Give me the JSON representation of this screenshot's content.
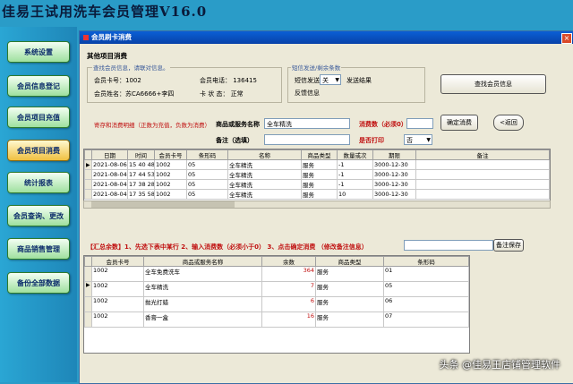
{
  "app": {
    "title": "佳易王试用洗车会员管理V16.0",
    "watermark": "头条 @佳易王店铺管理软件"
  },
  "nav": [
    {
      "label": "系统设置"
    },
    {
      "label": "会员信息登记"
    },
    {
      "label": "会员项目充值"
    },
    {
      "label": "会员项目消费"
    },
    {
      "label": "统计报表"
    },
    {
      "label": "会员查询、更改"
    },
    {
      "label": "商品销售管理"
    },
    {
      "label": "备份全部数据"
    }
  ],
  "window": {
    "title": "会员刷卡消费",
    "close": "×"
  },
  "section": {
    "title": "其他项目消费"
  },
  "member": {
    "group_label": "查找会员信息，请联对信息。",
    "card_no": "会员卡号：1002",
    "phone": "会员电话： 136415",
    "name": "会员姓名：苏CA6666+李四",
    "status": "卡 状 态： 正常"
  },
  "sms": {
    "group_label": "短信发送/剩余条数",
    "send_label": "短信发送",
    "send_value": "关",
    "result_label": "发送结果",
    "feedback_label": "反馈信息"
  },
  "buttons": {
    "find_member": "查找会员信息",
    "confirm": "确定消费",
    "back": "<返回",
    "save_note": "备注保存"
  },
  "form": {
    "hint": "寄存和消费明细（正数为充值，负数为消费）",
    "item_label": "商品或服务名称",
    "item_value": "全车精洗",
    "qty_label": "消费数（必须0）",
    "qty_value": "",
    "note_label": "备注（选填）",
    "note_value": "",
    "print_label": "是否打印",
    "print_value": "否"
  },
  "history": {
    "columns": [
      "日期",
      "时间",
      "会员卡号",
      "条形码",
      "名称",
      "商品类型",
      "数量或次",
      "期限",
      "备注"
    ],
    "rows": [
      [
        "2021-08-06",
        "15 40 48",
        "1002",
        "05",
        "全车精洗",
        "服务",
        "-1",
        "3000-12-30",
        ""
      ],
      [
        "2021-08-04",
        "17 44 53",
        "1002",
        "05",
        "全车精洗",
        "服务",
        "-1",
        "3000-12-30",
        ""
      ],
      [
        "2021-08-04",
        "17 38 28",
        "1002",
        "05",
        "全车精洗",
        "服务",
        "-1",
        "3000-12-30",
        ""
      ],
      [
        "2021-08-04",
        "17 35 58",
        "1002",
        "05",
        "全车精洗",
        "服务",
        "10",
        "3000-12-30",
        ""
      ]
    ]
  },
  "summary": {
    "text": "【汇总余数】1、先选下表中某行 2、输入消费数（必须小于0） 3、点击确定消费 （修改备注信息）"
  },
  "balance": {
    "columns": [
      "会员卡号",
      "商品或服务名称",
      "余数",
      "商品类型",
      "条形码"
    ],
    "rows": [
      [
        "1002",
        "全车免费洗车",
        "364",
        "服务",
        "01"
      ],
      [
        "1002",
        "全车精洗",
        "7",
        "服务",
        "05"
      ],
      [
        "1002",
        "抛光打蜡",
        "6",
        "服务",
        "06"
      ],
      [
        "1002",
        "香膏一盒",
        "16",
        "服务",
        "07"
      ]
    ]
  }
}
